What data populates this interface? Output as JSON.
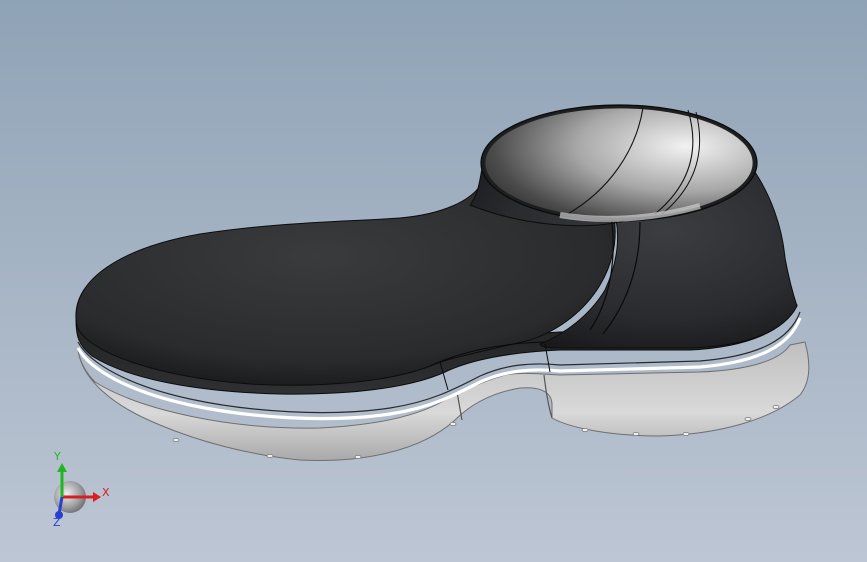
{
  "viewport": {
    "background_top": "#8fa3b6",
    "background_bottom": "#bdc6d4"
  },
  "model": {
    "name": "boot-model",
    "upper_color": "#2b2c2e",
    "sole_color": "#cdcdcd",
    "welt_color": "#ffffff"
  },
  "triad": {
    "x_label": "X",
    "y_label": "Y",
    "z_label": "Z",
    "x_color": "#d81e1e",
    "y_color": "#22b522",
    "z_color": "#2a3ed1"
  }
}
